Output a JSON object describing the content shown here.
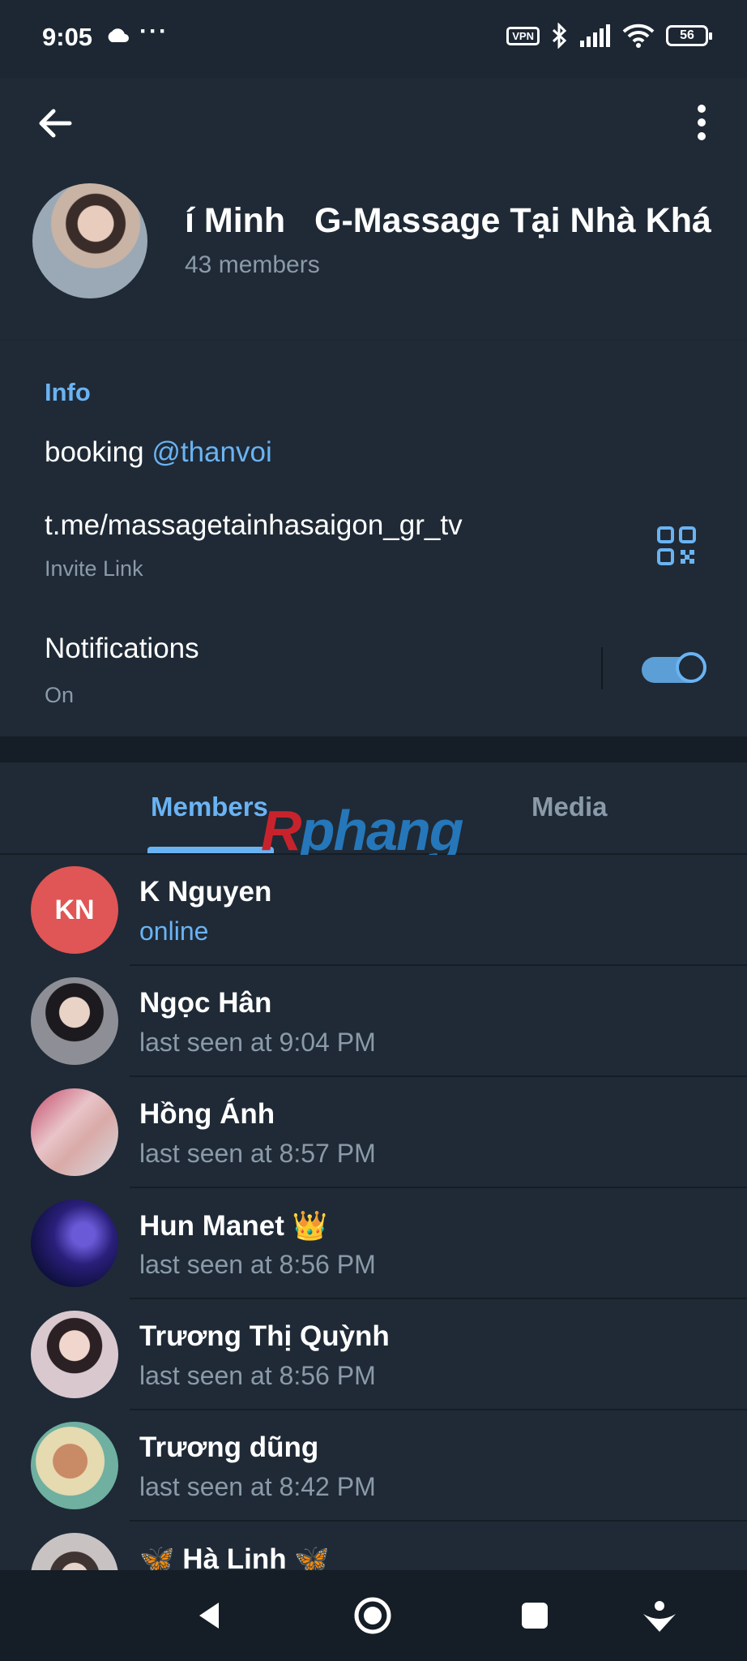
{
  "status_bar": {
    "time": "9:05",
    "overflow": "···",
    "vpn": "VPN",
    "battery": "56",
    "icons": [
      "cloud-icon",
      "vpn-icon",
      "bluetooth-icon",
      "signal-icon",
      "wifi-icon",
      "battery-icon"
    ]
  },
  "header": {
    "title": "í Minh   G-Massage Tại Nhà Khá",
    "members_count": "43 members",
    "back_icon": "arrow-left-icon",
    "menu_icon": "more-vertical-icon"
  },
  "info": {
    "section_label": "Info",
    "booking_text": "booking ",
    "booking_mention": "@thanvoi",
    "invite_link": "t.me/massagetainhasaigon_gr_tv",
    "invite_label": "Invite Link",
    "qr_icon": "qr-code-icon",
    "notifications_label": "Notifications",
    "notifications_value": "On",
    "notifications_enabled": true
  },
  "tabs": [
    {
      "label": "Members",
      "active": true
    },
    {
      "label": "Media",
      "active": false
    }
  ],
  "watermark": {
    "part_a": "R",
    "part_b": "phang"
  },
  "members": [
    {
      "name": "K Nguyen",
      "status": "online",
      "initials": "KN",
      "online": true
    },
    {
      "name": "Ngọc Hân",
      "status": "last seen at 9:04 PM"
    },
    {
      "name": "Hồng Ánh",
      "status": "last seen at 8:57 PM"
    },
    {
      "name": "Hun Manet 👑",
      "status": "last seen at 8:56 PM"
    },
    {
      "name": "Trương Thị Quỳnh",
      "status": "last seen at 8:56 PM"
    },
    {
      "name": "Trương dũng",
      "status": "last seen at 8:42 PM"
    },
    {
      "name": "🦋 Hà Linh 🦋",
      "status": ""
    }
  ],
  "nav_bar": [
    "back-triangle-icon",
    "home-circle-icon",
    "recents-square-icon",
    "assist-icon"
  ],
  "colors": {
    "accent": "#6ab3f3",
    "background": "#1d2733",
    "surface": "#1f2a36",
    "secondary_text": "#8b9aa8"
  }
}
